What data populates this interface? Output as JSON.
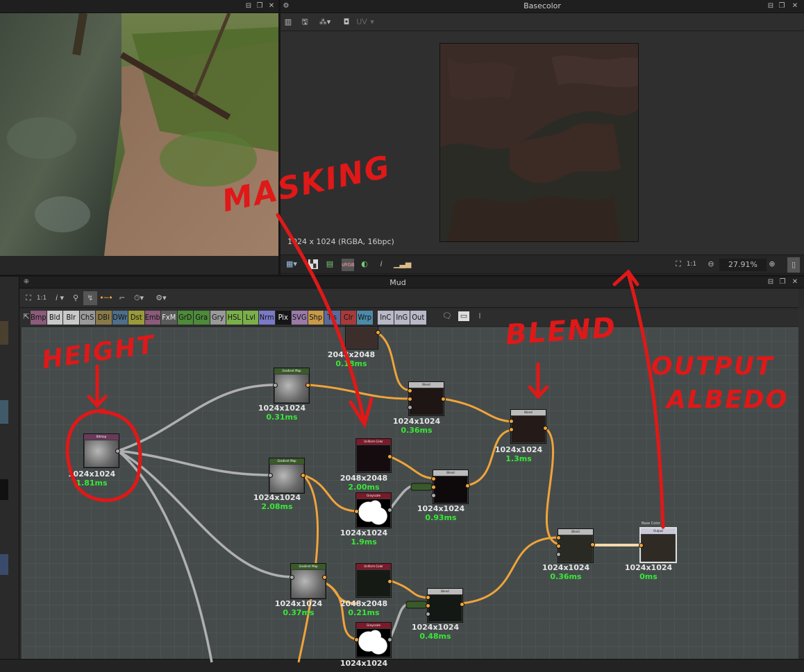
{
  "viewport3d": {
    "close": "✕"
  },
  "basecolor_panel": {
    "title": "Basecolor",
    "uv_label": "UV",
    "image_info": "1024 x 1024 (RGBA, 16bpc)",
    "ratio_label": "1:1",
    "zoom": "27.91%"
  },
  "graph_panel": {
    "title": "Mud",
    "ratio_label": "1:1",
    "library": [
      {
        "label": "Bmp",
        "color": "#8a5b7a"
      },
      {
        "label": "Bld",
        "color": "#c9c9c9"
      },
      {
        "label": "Blr",
        "color": "#c9c9c9"
      },
      {
        "label": "ChS",
        "color": "#9a9a9a"
      },
      {
        "label": "DBl",
        "color": "#8a7a4a"
      },
      {
        "label": "DWr",
        "color": "#4d6f8a"
      },
      {
        "label": "Dst",
        "color": "#9a9a3a"
      },
      {
        "label": "Emb",
        "color": "#8a5b7a"
      },
      {
        "label": "FxM",
        "color": "#5a5a5a"
      },
      {
        "label": "GrD",
        "color": "#4d8a3a"
      },
      {
        "label": "Gra",
        "color": "#4d8a3a"
      },
      {
        "label": "Gry",
        "color": "#9a9a9a"
      },
      {
        "label": "HSL",
        "color": "#7ab04a"
      },
      {
        "label": "Lvl",
        "color": "#7ab04a"
      },
      {
        "label": "Nrm",
        "color": "#7a7ac8"
      },
      {
        "label": "Pix",
        "color": "#151515"
      },
      {
        "label": "SVG",
        "color": "#9a7aa8"
      },
      {
        "label": "Shp",
        "color": "#c89a4a"
      },
      {
        "label": "Trs",
        "color": "#5a6a9a"
      },
      {
        "label": "Clr",
        "color": "#a83a3a"
      },
      {
        "label": "Wrp",
        "color": "#4d8aa8"
      },
      {
        "label": "InC",
        "color": "#b8b8c8"
      },
      {
        "label": "InG",
        "color": "#b8b8c8"
      },
      {
        "label": "Out",
        "color": "#b8b8c8"
      }
    ],
    "nodes": {
      "top_partial": {
        "size": "2048x2048",
        "time": "0.18ms"
      },
      "bitmap": {
        "name": "Bitmap",
        "size": "1024x1024",
        "time": "1.81ms"
      },
      "gradient_map_1": {
        "name": "Gradient Map",
        "size": "1024x1024",
        "time": "0.31ms"
      },
      "gradient_map_2": {
        "name": "Gradient Map",
        "size": "1024x1024",
        "time": "2.08ms"
      },
      "gradient_map_3": {
        "name": "Gradient Map",
        "size": "1024x1024",
        "time": "0.37ms"
      },
      "uniform_color_1": {
        "name": "Uniform Color",
        "size": "2048x2048",
        "time": "2.00ms"
      },
      "uniform_color_2": {
        "name": "Uniform Color",
        "size": "2048x2048",
        "time": "0.21ms"
      },
      "grayscale_1": {
        "name": "Grayscale",
        "size": "1024x1024",
        "time": "1.9ms"
      },
      "grayscale_2": {
        "name": "Grayscale",
        "size": "1024x1024",
        "time": ""
      },
      "blend_1": {
        "name": "Blend",
        "size": "1024x1024",
        "time": "0.36ms"
      },
      "blend_2": {
        "name": "Blend",
        "size": "1024x1024",
        "time": "1.3ms"
      },
      "blend_3": {
        "name": "Blend",
        "size": "1024x1024",
        "time": "0.93ms"
      },
      "blend_4": {
        "name": "Blend",
        "size": "1024x1024",
        "time": "0.36ms"
      },
      "blend_5": {
        "name": "Blend",
        "size": "1024x1024",
        "time": "0.48ms"
      },
      "output": {
        "name": "Output",
        "label": "Base Color",
        "size": "1024x1024",
        "time": "0ms"
      }
    }
  },
  "annotations": {
    "height": "HEIGHT",
    "masking": "MASKING",
    "blend": "BLEND",
    "output_1": "OUTPUT",
    "output_2": "ALBEDO"
  },
  "colors": {
    "annotation": "#e01818",
    "wire_orange": "#f0a43a",
    "wire_gray": "#b0b0b0",
    "time_green": "#38e838"
  }
}
